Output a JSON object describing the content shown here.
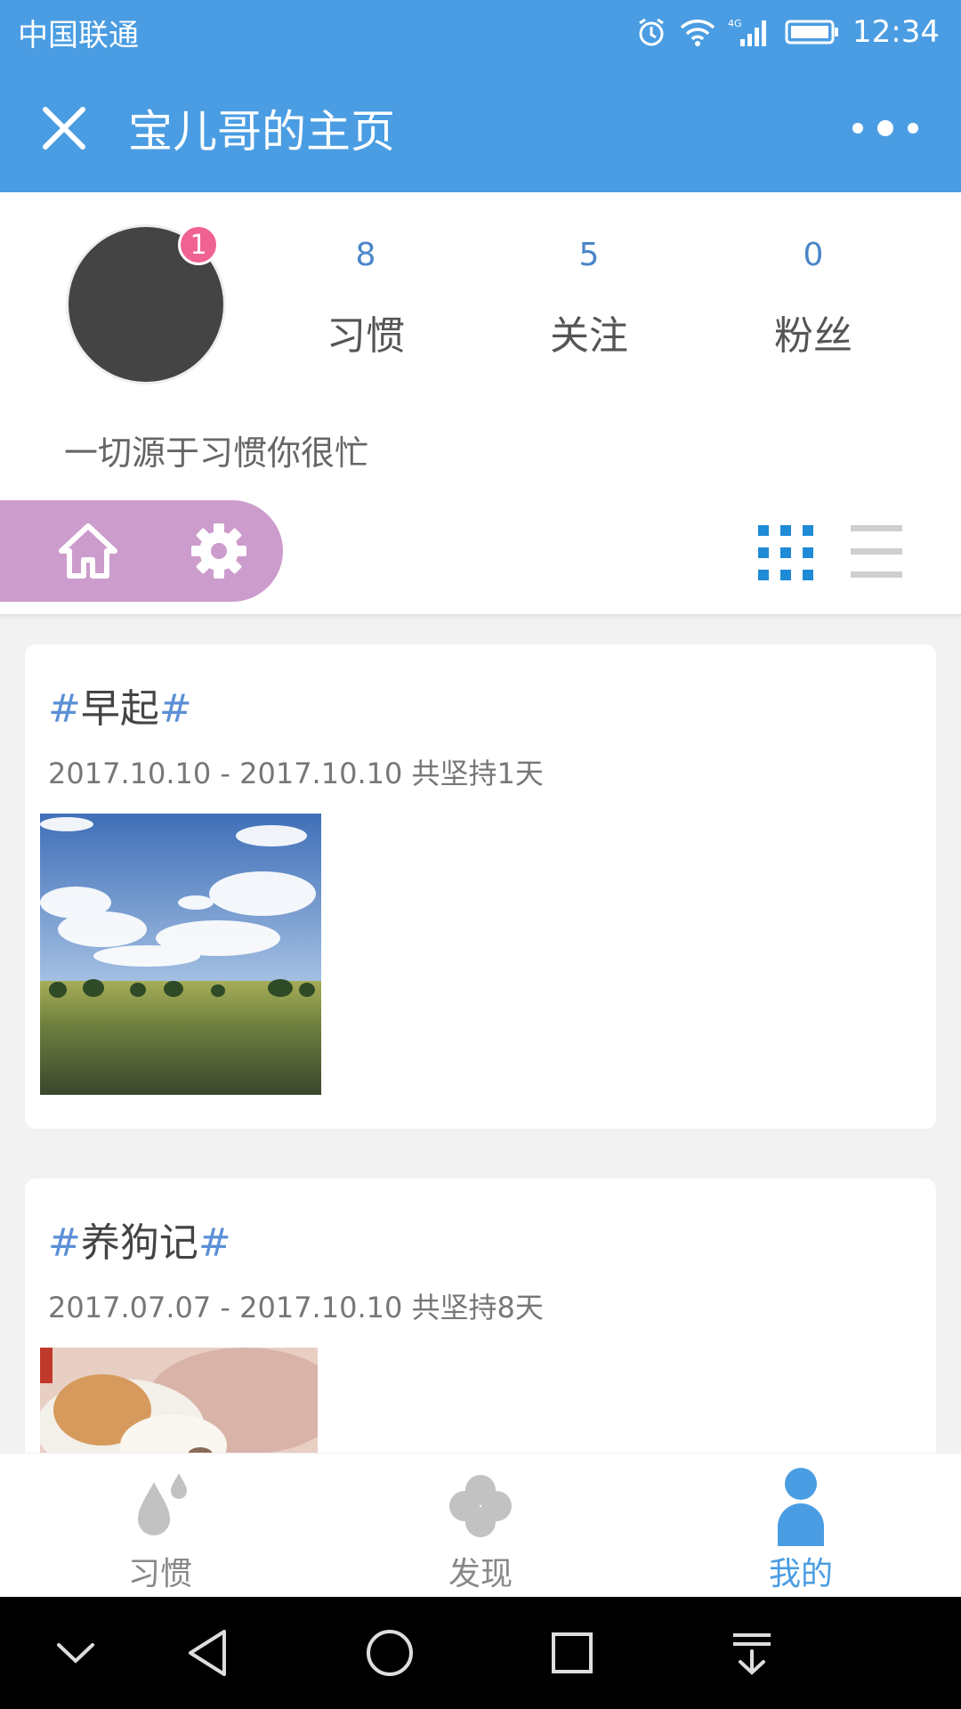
{
  "status": {
    "carrier": "中国联通",
    "time": "12:34",
    "network": "4G"
  },
  "header": {
    "title": "宝儿哥的主页"
  },
  "profile": {
    "badge_count": "1",
    "stats": [
      {
        "value": "8",
        "label": "习惯"
      },
      {
        "value": "5",
        "label": "关注"
      },
      {
        "value": "0",
        "label": "粉丝"
      }
    ],
    "signature": "一切源于习惯你很忙"
  },
  "cards": [
    {
      "hash_open": "#",
      "title": "早起",
      "hash_close": "#",
      "date_range": "2017.10.10 - 2017.10.10 共坚持1天",
      "photo": "sky-landscape-photo"
    },
    {
      "hash_open": "#",
      "title": "养狗记",
      "hash_close": "#",
      "date_range": "2017.07.07 - 2017.10.10 共坚持8天",
      "photo": "sleeping-dog-photo"
    }
  ],
  "tabs": [
    {
      "label": "习惯",
      "icon": "droplets-icon",
      "active": false
    },
    {
      "label": "发现",
      "icon": "clover-icon",
      "active": false
    },
    {
      "label": "我的",
      "icon": "person-icon",
      "active": true
    }
  ],
  "colors": {
    "primary": "#4a9de2",
    "pill": "#cc9ccc",
    "badge": "#f06292",
    "stat_number": "#4a86c8",
    "hash": "#5b8fd6"
  }
}
